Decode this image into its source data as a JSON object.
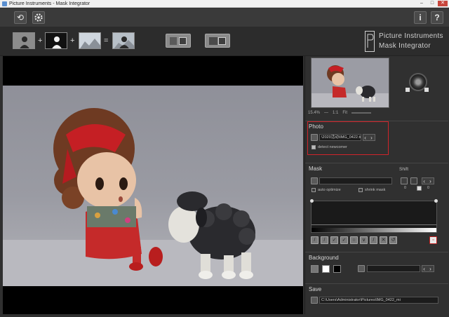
{
  "window": {
    "title": "Picture Instruments - Mask Integrator",
    "controls": [
      "–",
      "□",
      "✕"
    ]
  },
  "toolbar": {
    "reload_glyph": "⟲",
    "info_glyph": "i",
    "help_glyph": "?"
  },
  "formula": {
    "plus1": "+",
    "plus2": "+",
    "equals": "="
  },
  "brand": {
    "line1": "Picture Instruments",
    "line2": "Mask Integrator"
  },
  "navigator": {
    "zoom": "15.4%",
    "minus": "—",
    "ratio": "1:1",
    "fit": "Fit"
  },
  "photo": {
    "title": "Photo",
    "path": "\\2020活动\\IMG_0422.tif",
    "detect_label": "detect newcomer",
    "detect_checked": true,
    "nav_arrows": "‹ ›"
  },
  "mask": {
    "title": "Mask",
    "path": "",
    "auto_optimize_label": "auto optimize",
    "shrink_mask_label": "shrink mask",
    "shift_label": "Shift",
    "shift_value_left": "0",
    "shift_value_right": "0",
    "shift_arrows": "‹ ›"
  },
  "background": {
    "title": "Background",
    "path": "",
    "nav_arrows": "‹ ›"
  },
  "save": {
    "title": "Save",
    "path": "C:\\Users\\Administrator\\Pictures\\IMG_0422_mi"
  },
  "colors": {
    "highlight": "#d0242a",
    "panel": "#303030",
    "viewport_bg": "#000000"
  }
}
